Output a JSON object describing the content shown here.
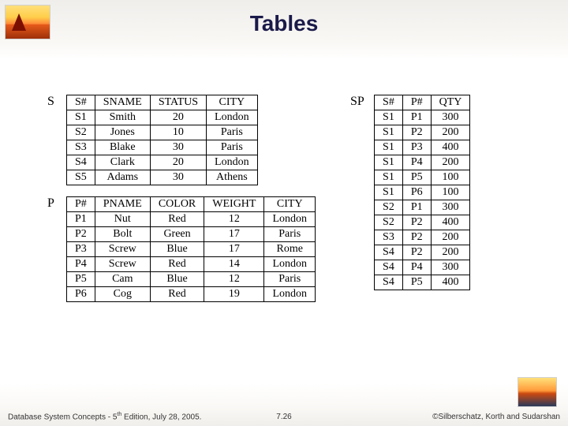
{
  "title": "Tables",
  "tables": {
    "S": {
      "label": "S",
      "headers": [
        "S#",
        "SNAME",
        "STATUS",
        "CITY"
      ],
      "rows": [
        [
          "S1",
          "Smith",
          "20",
          "London"
        ],
        [
          "S2",
          "Jones",
          "10",
          "Paris"
        ],
        [
          "S3",
          "Blake",
          "30",
          "Paris"
        ],
        [
          "S4",
          "Clark",
          "20",
          "London"
        ],
        [
          "S5",
          "Adams",
          "30",
          "Athens"
        ]
      ]
    },
    "P": {
      "label": "P",
      "headers": [
        "P#",
        "PNAME",
        "COLOR",
        "WEIGHT",
        "CITY"
      ],
      "rows": [
        [
          "P1",
          "Nut",
          "Red",
          "12",
          "London"
        ],
        [
          "P2",
          "Bolt",
          "Green",
          "17",
          "Paris"
        ],
        [
          "P3",
          "Screw",
          "Blue",
          "17",
          "Rome"
        ],
        [
          "P4",
          "Screw",
          "Red",
          "14",
          "London"
        ],
        [
          "P5",
          "Cam",
          "Blue",
          "12",
          "Paris"
        ],
        [
          "P6",
          "Cog",
          "Red",
          "19",
          "London"
        ]
      ]
    },
    "SP": {
      "label": "SP",
      "headers": [
        "S#",
        "P#",
        "QTY"
      ],
      "rows": [
        [
          "S1",
          "P1",
          "300"
        ],
        [
          "S1",
          "P2",
          "200"
        ],
        [
          "S1",
          "P3",
          "400"
        ],
        [
          "S1",
          "P4",
          "200"
        ],
        [
          "S1",
          "P5",
          "100"
        ],
        [
          "S1",
          "P6",
          "100"
        ],
        [
          "S2",
          "P1",
          "300"
        ],
        [
          "S2",
          "P2",
          "400"
        ],
        [
          "S3",
          "P2",
          "200"
        ],
        [
          "S4",
          "P2",
          "200"
        ],
        [
          "S4",
          "P4",
          "300"
        ],
        [
          "S4",
          "P5",
          "400"
        ]
      ]
    }
  },
  "footer": {
    "left_prefix": "Database System Concepts - 5",
    "left_sup": "th",
    "left_suffix": " Edition, July 28, 2005.",
    "center": "7.26",
    "right": "©Silberschatz, Korth and Sudarshan"
  }
}
